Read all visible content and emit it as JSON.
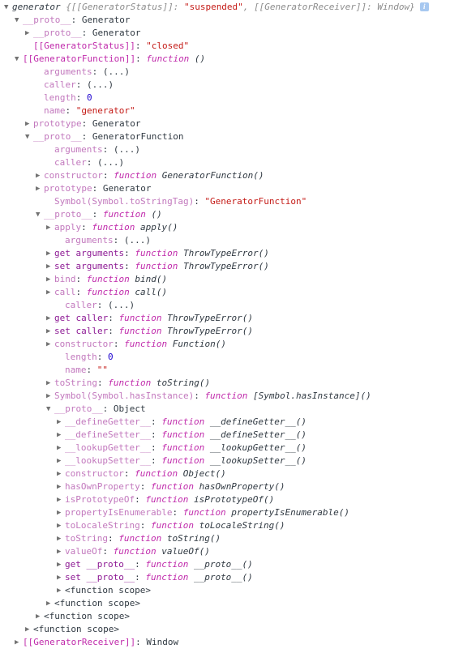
{
  "app": {
    "surface": "devtools-console-object-tree",
    "background": "#ffffff",
    "colors": {
      "property_name": "#c278bd",
      "property_name_own": "#8d1a94",
      "internal_slot": "#c02aab",
      "string_value": "#c41a16",
      "number_value": "#1c00cf",
      "keyword_function": "#c02aab",
      "text": "#303942",
      "triangle": "#727272",
      "info_badge": "#a7c8f0"
    }
  },
  "info_badge": {
    "glyph": "i",
    "label": "info-icon"
  },
  "rows": [
    {
      "indent": 0,
      "tri": "open",
      "tokens": [
        {
          "t": "generator ",
          "c": "desc"
        },
        {
          "t": "{",
          "c": "obj-preview"
        },
        {
          "t": "[[GeneratorStatus]]",
          "c": "obj-preview"
        },
        {
          "t": ": ",
          "c": "obj-preview"
        },
        {
          "t": "\"suspended\"",
          "c": "str"
        },
        {
          "t": ", ",
          "c": "obj-preview"
        },
        {
          "t": "[[GeneratorReceiver]]",
          "c": "obj-preview"
        },
        {
          "t": ": ",
          "c": "obj-preview"
        },
        {
          "t": "Window",
          "c": "obj-preview"
        },
        {
          "t": "}",
          "c": "obj-preview"
        }
      ],
      "badge": true
    },
    {
      "indent": 1,
      "tri": "open",
      "tokens": [
        {
          "t": "__proto__",
          "c": "name"
        },
        {
          "t": ": ",
          "c": "punc"
        },
        {
          "t": "Generator",
          "c": "val"
        }
      ]
    },
    {
      "indent": 2,
      "tri": "closed",
      "tokens": [
        {
          "t": "__proto__",
          "c": "name"
        },
        {
          "t": ": ",
          "c": "punc"
        },
        {
          "t": "Generator",
          "c": "val"
        }
      ]
    },
    {
      "indent": 2,
      "tri": "none",
      "tokens": [
        {
          "t": "[[GeneratorStatus]]",
          "c": "name-intern"
        },
        {
          "t": ": ",
          "c": "punc"
        },
        {
          "t": "\"closed\"",
          "c": "str"
        }
      ]
    },
    {
      "indent": 1,
      "tri": "open",
      "tokens": [
        {
          "t": "[[GeneratorFunction]]",
          "c": "name-intern"
        },
        {
          "t": ": ",
          "c": "punc"
        },
        {
          "t": "function",
          "c": "kw"
        },
        {
          "t": " ()",
          "c": "fnname"
        }
      ]
    },
    {
      "indent": 3,
      "tri": "none",
      "tokens": [
        {
          "t": "arguments",
          "c": "name"
        },
        {
          "t": ": ",
          "c": "punc"
        },
        {
          "t": "(...)",
          "c": "dots"
        }
      ]
    },
    {
      "indent": 3,
      "tri": "none",
      "tokens": [
        {
          "t": "caller",
          "c": "name"
        },
        {
          "t": ": ",
          "c": "punc"
        },
        {
          "t": "(...)",
          "c": "dots"
        }
      ]
    },
    {
      "indent": 3,
      "tri": "none",
      "tokens": [
        {
          "t": "length",
          "c": "name"
        },
        {
          "t": ": ",
          "c": "punc"
        },
        {
          "t": "0",
          "c": "num"
        }
      ]
    },
    {
      "indent": 3,
      "tri": "none",
      "tokens": [
        {
          "t": "name",
          "c": "name"
        },
        {
          "t": ": ",
          "c": "punc"
        },
        {
          "t": "\"generator\"",
          "c": "str"
        }
      ]
    },
    {
      "indent": 2,
      "tri": "closed",
      "tokens": [
        {
          "t": "prototype",
          "c": "name"
        },
        {
          "t": ": ",
          "c": "punc"
        },
        {
          "t": "Generator",
          "c": "val"
        }
      ]
    },
    {
      "indent": 2,
      "tri": "open",
      "tokens": [
        {
          "t": "__proto__",
          "c": "name"
        },
        {
          "t": ": ",
          "c": "punc"
        },
        {
          "t": "GeneratorFunction",
          "c": "val"
        }
      ]
    },
    {
      "indent": 4,
      "tri": "none",
      "tokens": [
        {
          "t": "arguments",
          "c": "name"
        },
        {
          "t": ": ",
          "c": "punc"
        },
        {
          "t": "(...)",
          "c": "dots"
        }
      ]
    },
    {
      "indent": 4,
      "tri": "none",
      "tokens": [
        {
          "t": "caller",
          "c": "name"
        },
        {
          "t": ": ",
          "c": "punc"
        },
        {
          "t": "(...)",
          "c": "dots"
        }
      ]
    },
    {
      "indent": 3,
      "tri": "closed",
      "tokens": [
        {
          "t": "constructor",
          "c": "name"
        },
        {
          "t": ": ",
          "c": "punc"
        },
        {
          "t": "function",
          "c": "kw"
        },
        {
          "t": " GeneratorFunction()",
          "c": "fnname"
        }
      ]
    },
    {
      "indent": 3,
      "tri": "closed",
      "tokens": [
        {
          "t": "prototype",
          "c": "name"
        },
        {
          "t": ": ",
          "c": "punc"
        },
        {
          "t": "Generator",
          "c": "val"
        }
      ]
    },
    {
      "indent": 4,
      "tri": "none",
      "tokens": [
        {
          "t": "Symbol(Symbol.toStringTag)",
          "c": "name"
        },
        {
          "t": ": ",
          "c": "punc"
        },
        {
          "t": "\"GeneratorFunction\"",
          "c": "str"
        }
      ]
    },
    {
      "indent": 3,
      "tri": "open",
      "tokens": [
        {
          "t": "__proto__",
          "c": "name"
        },
        {
          "t": ": ",
          "c": "punc"
        },
        {
          "t": "function",
          "c": "kw"
        },
        {
          "t": " ()",
          "c": "fnname"
        }
      ]
    },
    {
      "indent": 4,
      "tri": "closed",
      "tokens": [
        {
          "t": "apply",
          "c": "name"
        },
        {
          "t": ": ",
          "c": "punc"
        },
        {
          "t": "function",
          "c": "kw"
        },
        {
          "t": " apply()",
          "c": "fnname"
        }
      ]
    },
    {
      "indent": 5,
      "tri": "none",
      "tokens": [
        {
          "t": "arguments",
          "c": "name"
        },
        {
          "t": ": ",
          "c": "punc"
        },
        {
          "t": "(...)",
          "c": "dots"
        }
      ]
    },
    {
      "indent": 4,
      "tri": "closed",
      "tokens": [
        {
          "t": "get arguments",
          "c": "name-dark"
        },
        {
          "t": ": ",
          "c": "punc"
        },
        {
          "t": "function",
          "c": "kw"
        },
        {
          "t": " ThrowTypeError()",
          "c": "fnname"
        }
      ]
    },
    {
      "indent": 4,
      "tri": "closed",
      "tokens": [
        {
          "t": "set arguments",
          "c": "name-dark"
        },
        {
          "t": ": ",
          "c": "punc"
        },
        {
          "t": "function",
          "c": "kw"
        },
        {
          "t": " ThrowTypeError()",
          "c": "fnname"
        }
      ]
    },
    {
      "indent": 4,
      "tri": "closed",
      "tokens": [
        {
          "t": "bind",
          "c": "name"
        },
        {
          "t": ": ",
          "c": "punc"
        },
        {
          "t": "function",
          "c": "kw"
        },
        {
          "t": " bind()",
          "c": "fnname"
        }
      ]
    },
    {
      "indent": 4,
      "tri": "closed",
      "tokens": [
        {
          "t": "call",
          "c": "name"
        },
        {
          "t": ": ",
          "c": "punc"
        },
        {
          "t": "function",
          "c": "kw"
        },
        {
          "t": " call()",
          "c": "fnname"
        }
      ]
    },
    {
      "indent": 5,
      "tri": "none",
      "tokens": [
        {
          "t": "caller",
          "c": "name"
        },
        {
          "t": ": ",
          "c": "punc"
        },
        {
          "t": "(...)",
          "c": "dots"
        }
      ]
    },
    {
      "indent": 4,
      "tri": "closed",
      "tokens": [
        {
          "t": "get caller",
          "c": "name-dark"
        },
        {
          "t": ": ",
          "c": "punc"
        },
        {
          "t": "function",
          "c": "kw"
        },
        {
          "t": " ThrowTypeError()",
          "c": "fnname"
        }
      ]
    },
    {
      "indent": 4,
      "tri": "closed",
      "tokens": [
        {
          "t": "set caller",
          "c": "name-dark"
        },
        {
          "t": ": ",
          "c": "punc"
        },
        {
          "t": "function",
          "c": "kw"
        },
        {
          "t": " ThrowTypeError()",
          "c": "fnname"
        }
      ]
    },
    {
      "indent": 4,
      "tri": "closed",
      "tokens": [
        {
          "t": "constructor",
          "c": "name"
        },
        {
          "t": ": ",
          "c": "punc"
        },
        {
          "t": "function",
          "c": "kw"
        },
        {
          "t": " Function()",
          "c": "fnname"
        }
      ]
    },
    {
      "indent": 5,
      "tri": "none",
      "tokens": [
        {
          "t": "length",
          "c": "name"
        },
        {
          "t": ": ",
          "c": "punc"
        },
        {
          "t": "0",
          "c": "num"
        }
      ]
    },
    {
      "indent": 5,
      "tri": "none",
      "tokens": [
        {
          "t": "name",
          "c": "name"
        },
        {
          "t": ": ",
          "c": "punc"
        },
        {
          "t": "\"\"",
          "c": "str"
        }
      ]
    },
    {
      "indent": 4,
      "tri": "closed",
      "tokens": [
        {
          "t": "toString",
          "c": "name"
        },
        {
          "t": ": ",
          "c": "punc"
        },
        {
          "t": "function",
          "c": "kw"
        },
        {
          "t": " toString()",
          "c": "fnname"
        }
      ]
    },
    {
      "indent": 4,
      "tri": "closed",
      "tokens": [
        {
          "t": "Symbol(Symbol.hasInstance)",
          "c": "name"
        },
        {
          "t": ": ",
          "c": "punc"
        },
        {
          "t": "function",
          "c": "kw"
        },
        {
          "t": " [Symbol.hasInstance]()",
          "c": "fnname"
        }
      ]
    },
    {
      "indent": 4,
      "tri": "open",
      "tokens": [
        {
          "t": "__proto__",
          "c": "name"
        },
        {
          "t": ": ",
          "c": "punc"
        },
        {
          "t": "Object",
          "c": "val"
        }
      ]
    },
    {
      "indent": 5,
      "tri": "closed",
      "tokens": [
        {
          "t": "__defineGetter__",
          "c": "name"
        },
        {
          "t": ": ",
          "c": "punc"
        },
        {
          "t": "function",
          "c": "kw"
        },
        {
          "t": " __defineGetter__()",
          "c": "fnname"
        }
      ]
    },
    {
      "indent": 5,
      "tri": "closed",
      "tokens": [
        {
          "t": "__defineSetter__",
          "c": "name"
        },
        {
          "t": ": ",
          "c": "punc"
        },
        {
          "t": "function",
          "c": "kw"
        },
        {
          "t": " __defineSetter__()",
          "c": "fnname"
        }
      ]
    },
    {
      "indent": 5,
      "tri": "closed",
      "tokens": [
        {
          "t": "__lookupGetter__",
          "c": "name"
        },
        {
          "t": ": ",
          "c": "punc"
        },
        {
          "t": "function",
          "c": "kw"
        },
        {
          "t": " __lookupGetter__()",
          "c": "fnname"
        }
      ]
    },
    {
      "indent": 5,
      "tri": "closed",
      "tokens": [
        {
          "t": "__lookupSetter__",
          "c": "name"
        },
        {
          "t": ": ",
          "c": "punc"
        },
        {
          "t": "function",
          "c": "kw"
        },
        {
          "t": " __lookupSetter__()",
          "c": "fnname"
        }
      ]
    },
    {
      "indent": 5,
      "tri": "closed",
      "tokens": [
        {
          "t": "constructor",
          "c": "name"
        },
        {
          "t": ": ",
          "c": "punc"
        },
        {
          "t": "function",
          "c": "kw"
        },
        {
          "t": " Object()",
          "c": "fnname"
        }
      ]
    },
    {
      "indent": 5,
      "tri": "closed",
      "tokens": [
        {
          "t": "hasOwnProperty",
          "c": "name"
        },
        {
          "t": ": ",
          "c": "punc"
        },
        {
          "t": "function",
          "c": "kw"
        },
        {
          "t": " hasOwnProperty()",
          "c": "fnname"
        }
      ]
    },
    {
      "indent": 5,
      "tri": "closed",
      "tokens": [
        {
          "t": "isPrototypeOf",
          "c": "name"
        },
        {
          "t": ": ",
          "c": "punc"
        },
        {
          "t": "function",
          "c": "kw"
        },
        {
          "t": " isPrototypeOf()",
          "c": "fnname"
        }
      ]
    },
    {
      "indent": 5,
      "tri": "closed",
      "tokens": [
        {
          "t": "propertyIsEnumerable",
          "c": "name"
        },
        {
          "t": ": ",
          "c": "punc"
        },
        {
          "t": "function",
          "c": "kw"
        },
        {
          "t": " propertyIsEnumerable()",
          "c": "fnname"
        }
      ]
    },
    {
      "indent": 5,
      "tri": "closed",
      "tokens": [
        {
          "t": "toLocaleString",
          "c": "name"
        },
        {
          "t": ": ",
          "c": "punc"
        },
        {
          "t": "function",
          "c": "kw"
        },
        {
          "t": " toLocaleString()",
          "c": "fnname"
        }
      ]
    },
    {
      "indent": 5,
      "tri": "closed",
      "tokens": [
        {
          "t": "toString",
          "c": "name"
        },
        {
          "t": ": ",
          "c": "punc"
        },
        {
          "t": "function",
          "c": "kw"
        },
        {
          "t": " toString()",
          "c": "fnname"
        }
      ]
    },
    {
      "indent": 5,
      "tri": "closed",
      "tokens": [
        {
          "t": "valueOf",
          "c": "name"
        },
        {
          "t": ": ",
          "c": "punc"
        },
        {
          "t": "function",
          "c": "kw"
        },
        {
          "t": " valueOf()",
          "c": "fnname"
        }
      ]
    },
    {
      "indent": 5,
      "tri": "closed",
      "tokens": [
        {
          "t": "get __proto__",
          "c": "name-dark"
        },
        {
          "t": ": ",
          "c": "punc"
        },
        {
          "t": "function",
          "c": "kw"
        },
        {
          "t": " __proto__()",
          "c": "fnname"
        }
      ]
    },
    {
      "indent": 5,
      "tri": "closed",
      "tokens": [
        {
          "t": "set __proto__",
          "c": "name-dark"
        },
        {
          "t": ": ",
          "c": "punc"
        },
        {
          "t": "function",
          "c": "kw"
        },
        {
          "t": " __proto__()",
          "c": "fnname"
        }
      ]
    },
    {
      "indent": 5,
      "tri": "closed",
      "tokens": [
        {
          "t": "<function scope>",
          "c": "scope"
        }
      ]
    },
    {
      "indent": 4,
      "tri": "closed",
      "tokens": [
        {
          "t": "<function scope>",
          "c": "scope"
        }
      ]
    },
    {
      "indent": 3,
      "tri": "closed",
      "tokens": [
        {
          "t": "<function scope>",
          "c": "scope"
        }
      ]
    },
    {
      "indent": 2,
      "tri": "closed",
      "tokens": [
        {
          "t": "<function scope>",
          "c": "scope"
        }
      ]
    },
    {
      "indent": 1,
      "tri": "closed",
      "tokens": [
        {
          "t": "[[GeneratorReceiver]]",
          "c": "name-intern"
        },
        {
          "t": ": ",
          "c": "punc"
        },
        {
          "t": "Window",
          "c": "val"
        }
      ]
    }
  ]
}
